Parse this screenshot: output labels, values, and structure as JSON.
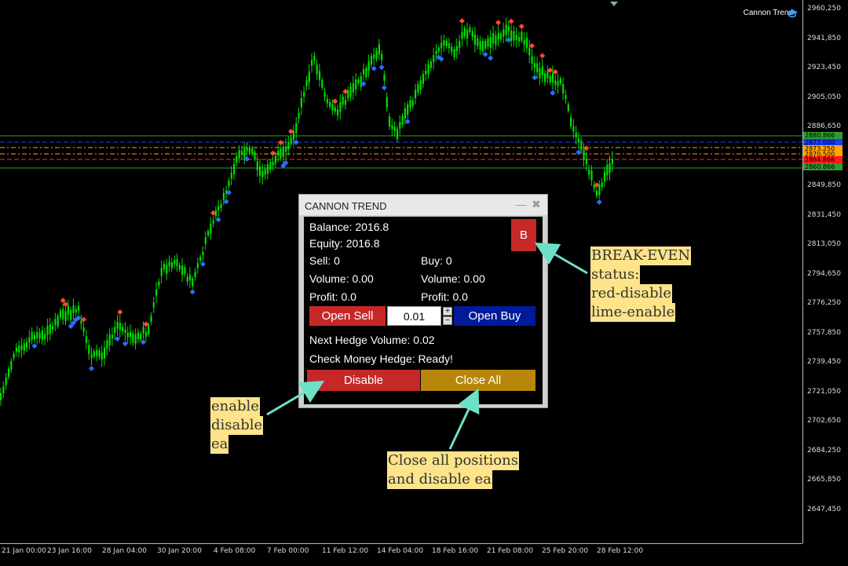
{
  "chart": {
    "indicator_name": "Cannon Trend",
    "price_ticks": [
      "2960,250",
      "2941,850",
      "2923,450",
      "2905,050",
      "2886,650",
      "2868,250",
      "2849,850",
      "2831,450",
      "2813,050",
      "2794,650",
      "2776,250",
      "2757,850",
      "2739,450",
      "2721,050",
      "2702,650",
      "2684,250",
      "2665,850",
      "2647,450"
    ],
    "time_ticks": [
      "21 Jan 00:00",
      "23 Jan 16:00",
      "28 Jan 04:00",
      "30 Jan 20:00",
      "4 Feb 08:00",
      "7 Feb 00:00",
      "11 Feb 12:00",
      "14 Feb 04:00",
      "18 Feb 16:00",
      "21 Feb 08:00",
      "25 Feb 20:00",
      "28 Feb 12:00"
    ],
    "price_tags": [
      {
        "label": "2880.866",
        "color": "#2e9d2e"
      },
      {
        "label": "2877.000",
        "color": "#1a3cff"
      },
      {
        "label": "2873.250",
        "color": "#ffa500"
      },
      {
        "label": "2870.500",
        "color": "#ffa500"
      },
      {
        "label": "2864.866",
        "color": "#ff1a1a"
      },
      {
        "label": "2860.866",
        "color": "#2e9d2e"
      }
    ],
    "colors": {
      "candle": "#00e000",
      "buy_marker": "#2a6cff",
      "sell_marker": "#ff4a2a",
      "axis_text": "#dddddd"
    }
  },
  "panel": {
    "title": "CANNON TREND",
    "balance": "Balance: 2016.8",
    "equity": "Equity: 2016.8",
    "sell": "Sell: 0",
    "buy": "Buy: 0",
    "sell_volume": "Volume: 0.00",
    "buy_volume": "Volume: 0.00",
    "sell_profit": "Profit: 0.0",
    "buy_profit": "Profit: 0.0",
    "open_sell_label": "Open Sell",
    "lot_value": "0.01",
    "open_buy_label": "Open Buy",
    "next_hedge": "Next Hedge Volume: 0.02",
    "check_money": "Check Money Hedge: Ready!",
    "disable_label": "Disable",
    "close_all_label": "Close All",
    "breakeven_label": "B",
    "colors": {
      "sell": "#c62828",
      "buy": "#001a99",
      "disable": "#c62828",
      "close_all": "#b8860b",
      "breakeven": "#c62828"
    }
  },
  "annotations": {
    "breakeven": [
      "BREAK-EVEN",
      "status:",
      "red-disable",
      "lime-enable"
    ],
    "disable": [
      "enable",
      "disable",
      "ea"
    ],
    "close_all": [
      "Close all positions",
      "and disable ea"
    ],
    "highlight_color": "#fde48a",
    "arrow_color": "#6ee0c8"
  }
}
